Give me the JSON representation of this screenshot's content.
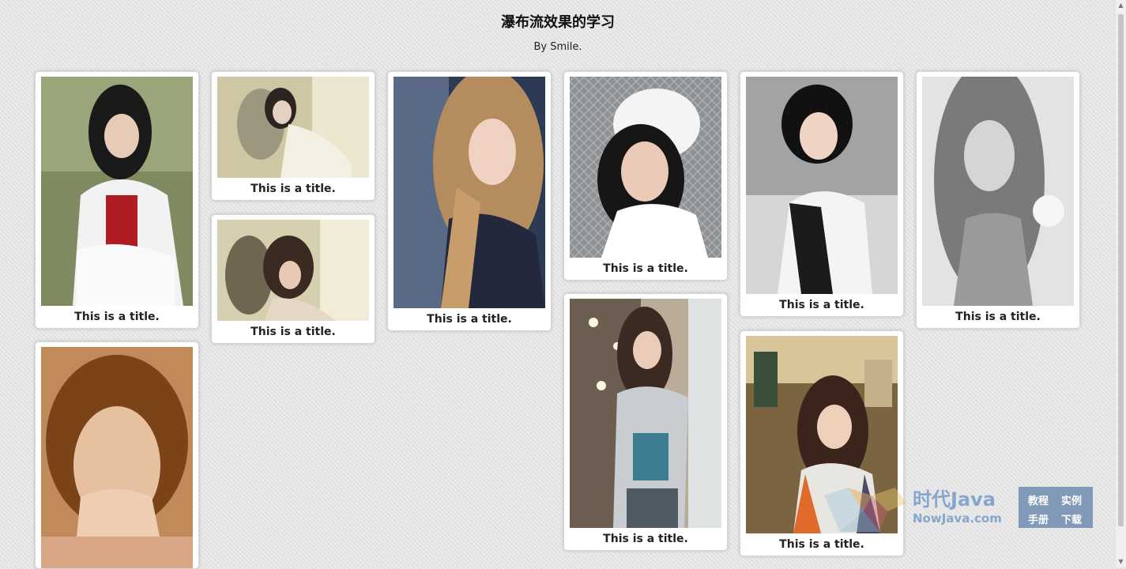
{
  "page": {
    "heading": "瀑布流效果的学习",
    "byline": "By Smile."
  },
  "cards": [
    {
      "caption": "This is a title.",
      "photo": "photo-woman-white-jacket"
    },
    {
      "caption": "This is a title.",
      "photo": "photo-woman-reclining"
    },
    {
      "caption": "This is a title.",
      "photo": "photo-woman-sleeping"
    },
    {
      "caption": "This is a title.",
      "photo": "photo-blonde-woman"
    },
    {
      "caption": "This is a title.",
      "photo": "photo-woman-white-hat"
    },
    {
      "caption": "This is a title.",
      "photo": "photo-woman-grey-hoodie"
    },
    {
      "caption": "This is a title.",
      "photo": "photo-woman-earrings"
    },
    {
      "caption": "This is a title.",
      "photo": "photo-woman-orange-jacket"
    },
    {
      "caption": "This is a title.",
      "photo": "photo-woman-bw"
    },
    {
      "caption": "",
      "photo": "photo-woman-short-hair"
    }
  ],
  "watermark": {
    "name": "时代Java",
    "url": "NowJava.com",
    "links": [
      "教程",
      "实例",
      "手册",
      "下载"
    ]
  }
}
